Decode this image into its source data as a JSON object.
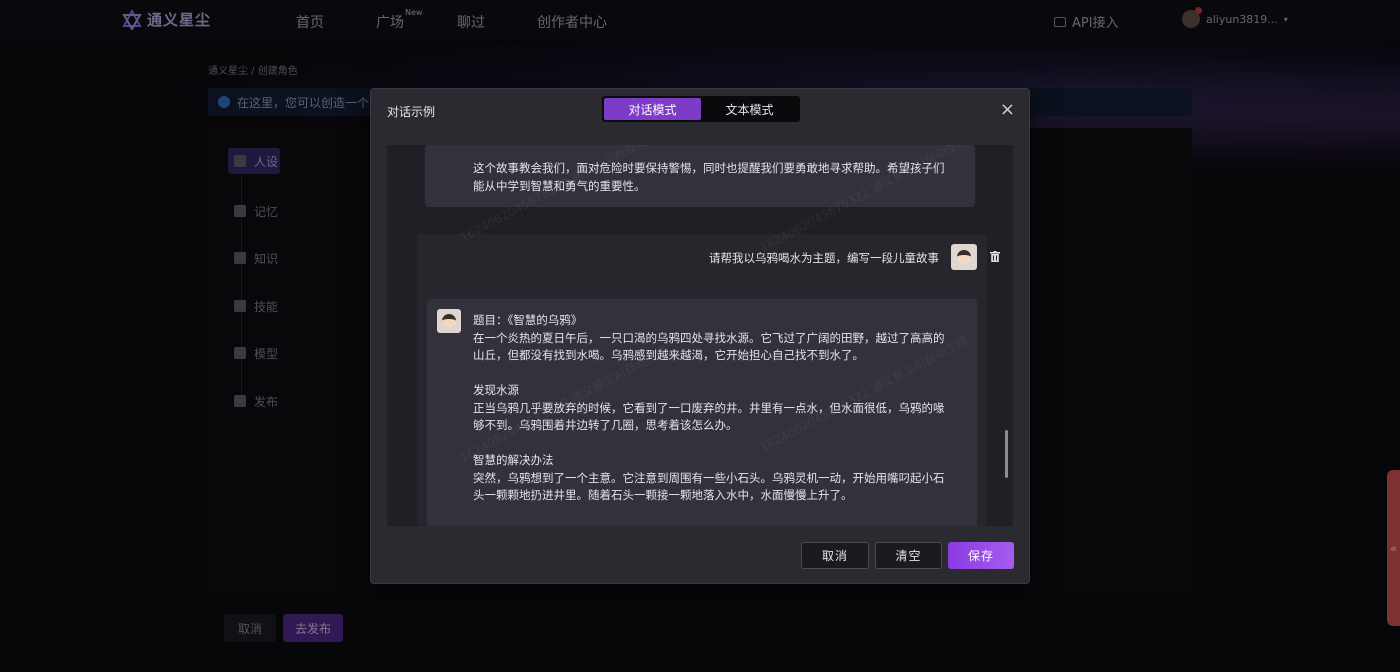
{
  "topnav": {
    "brand": "通义星尘",
    "items": [
      "首页",
      "广场",
      "聊过",
      "创作者中心"
    ],
    "new_badge": "New",
    "api": "API接入",
    "user": "aliyun3819..."
  },
  "breadcrumb": "通义星尘 / 创建角色",
  "info_bar": "在这里，您可以创造一个",
  "side_menu": [
    "人设",
    "记忆",
    "知识",
    "技能",
    "模型",
    "发布"
  ],
  "bottom_buttons": {
    "cancel": "取消",
    "publish": "去发布"
  },
  "float_tab": "«",
  "modal": {
    "title": "对话示例",
    "tabs": [
      "对话模式",
      "文本模式"
    ],
    "close": "×",
    "prev_message": "这个故事教会我们，面对危险时要保持警惕，同时也提醒我们要勇敢地寻求帮助。希望孩子们能从中学到智慧和勇气的重要性。",
    "user_message": "请帮我以乌鸦喝水为主题，编写一段儿童故事",
    "bot_message": "题目：《智慧的乌鸦》\n在一个炎热的夏日午后，一只口渴的乌鸦四处寻找水源。它飞过了广阔的田野，越过了高高的山丘，但都没有找到水喝。乌鸦感到越来越渴，它开始担心自己找不到水了。\n\n发现水源\n正当乌鸦几乎要放弃的时候，它看到了一口废弃的井。井里有一点水，但水面很低，乌鸦的喙够不到。乌鸦围着井边转了几圈，思考着该怎么办。\n\n智慧的解决办法\n突然，乌鸦想到了一个主意。它注意到周围有一些小石头。乌鸦灵机一动，开始用嘴叼起小石头一颗颗地扔进井里。随着石头一颗接一颗地落入水中，水面慢慢上升了。",
    "buttons": {
      "cancel": "取消",
      "clear": "清空",
      "save": "保存"
    }
  },
  "watermark": "1624062045675322 通义星尘AI自动生成",
  "colors": {
    "accent": "#7d3cc8",
    "save_gradient_end": "#a55cf0",
    "float_tab": "#e85a5a"
  },
  "icons": [
    "logo-icon",
    "api-icon",
    "user-avatar-icon",
    "persona-icon",
    "memory-icon",
    "knowledge-icon",
    "skill-icon",
    "model-icon",
    "publish-icon",
    "close-icon",
    "delete-icon"
  ]
}
